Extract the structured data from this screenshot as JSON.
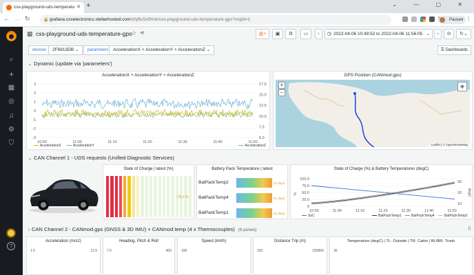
{
  "browser": {
    "tab_title": "css-playground-uds-temperatu",
    "url_host": "grafana.csselectronics.stellarhosted.com",
    "url_path": "/d/yBc5x9Xnk/css-playground-uds-temperature-gps?orgId=1",
    "profile_label": "Paused"
  },
  "dashboard": {
    "title": "css-playground-uds-temperature-gps",
    "time_range": "2022-04-06 10:49:52 to 2022-04-06 11:56:05",
    "dashboards_button": "Dashboards"
  },
  "variables": [
    {
      "label": "devices",
      "value": "2F6913DB"
    },
    {
      "label": "parameters",
      "value": "AccelerationX + AccelerationY + AccelerationZ"
    }
  ],
  "rows": {
    "dynamic": "Dynamic (update via 'parameters')",
    "can1": "CAN Channel 1 - UDS requests (Unified Diagnostic Services)",
    "can2": "CAN Channel 2 - CANmod.gps (GNSS & 3D IMU) + CANmod.temp (4 x Thermocouples)",
    "can2_sub": "(6 panels)"
  },
  "accel_panel": {
    "title": "AccelerationX + AccelerationY + AccelerationZ",
    "left_ticks": [
      "3",
      "2",
      "1",
      "0",
      "-1",
      "-2",
      "-3"
    ],
    "right_ticks": [
      "17.5",
      "15.0",
      "12.5",
      "10.0",
      "7.5",
      "5.0"
    ],
    "x_ticks": [
      "10:50",
      "11:00",
      "11:10",
      "11:20",
      "11:30",
      "11:40",
      "11:50"
    ],
    "legend": [
      "AccelerationX",
      "AccelerationY",
      "AccelerationZ"
    ],
    "colors": {
      "x": "#d4b106",
      "y": "#7eb26d",
      "z": "#56a8c9"
    }
  },
  "gps_panel": {
    "title": "GPS Position (CANmod.gps)",
    "attribution": "Leaflet | © OpenStreetMap",
    "zoom_in": "+",
    "zoom_out": "−"
  },
  "soc_panel": {
    "title": "State of Charge | latest (%)",
    "value": "26.1 %",
    "value_fraction": 0.261
  },
  "bpt_panel": {
    "title": "Battery Pack Temperature | latest",
    "rows": [
      {
        "name": "BatPackTemp2",
        "value": "22 degC",
        "fill": 1.0
      },
      {
        "name": "BatPackTemp4",
        "value": "21 degC",
        "fill": 1.0
      },
      {
        "name": "BatPackTemp1",
        "value": "22 degC",
        "fill": 1.0
      }
    ]
  },
  "soc_temp_panel": {
    "title": "State of Charge (%) & Battery Temperatures (degC)",
    "left_ticks": [
      "100.0",
      "75.0",
      "50.0",
      "25.0",
      "0"
    ],
    "right_ticks": [
      "30",
      "20",
      "10"
    ],
    "x_ticks": [
      "10:50",
      "11:00",
      "11:10",
      "11:20",
      "11:30",
      "11:40",
      "11:50"
    ],
    "ylabel_left": "%",
    "ylabel_right": "degC",
    "legend": [
      "SoC",
      "BatPackTemp1",
      "BatPackTemp4",
      "BatPackTemp2"
    ]
  },
  "bottom_panels": [
    {
      "title": "Acceleration (m/s2)"
    },
    {
      "title": "Heading, Pitch & Roll"
    },
    {
      "title": "Speed (km/h)"
    },
    {
      "title": "Distance Trip (m)"
    },
    {
      "title": "Temperature (degC) | TL: Outside | TR: Cabin | BL/BR: Trunk"
    }
  ],
  "bottom_ticks": [
    {
      "left": "1.5",
      "right": "11.5"
    },
    {
      "left": "7.5",
      "right": "400"
    },
    {
      "left": "100",
      "right": ""
    },
    {
      "left": "150",
      "right": "150000"
    },
    {
      "left": "30",
      "right": ""
    }
  ]
}
